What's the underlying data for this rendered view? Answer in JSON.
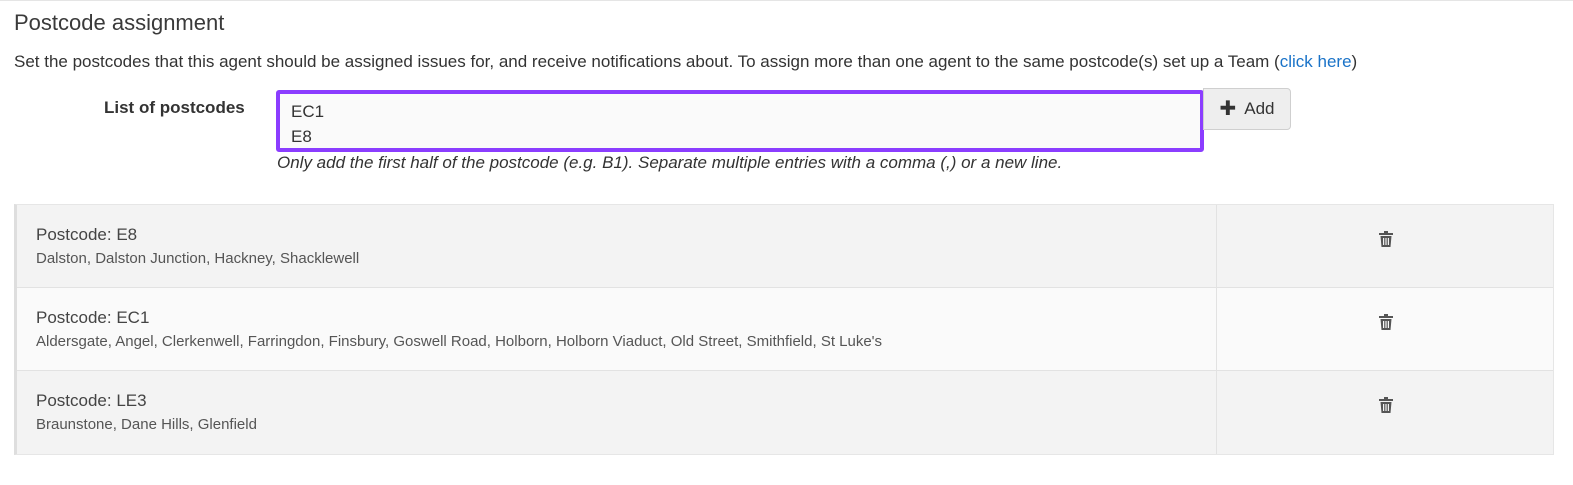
{
  "section": {
    "title": "Postcode assignment",
    "intro_text": "Set the postcodes that this agent should be assigned issues for, and receive notifications about. To assign more than one agent to the same postcode(s) set up a Team (",
    "intro_link": "click here",
    "intro_close": ")"
  },
  "form": {
    "label": "List of postcodes",
    "value": "EC1\nE8",
    "add_label": "Add",
    "add_icon": "plus-icon",
    "help_text": "Only add the first half of the postcode (e.g. B1). Separate multiple entries with a comma (,) or a new line."
  },
  "postcodes": [
    {
      "title": "Postcode: E8",
      "areas": "Dalston, Dalston Junction, Hackney, Shacklewell"
    },
    {
      "title": "Postcode: EC1",
      "areas": "Aldersgate, Angel, Clerkenwell, Farringdon, Finsbury, Goswell Road, Holborn, Holborn Viaduct, Old Street, Smithfield, St Luke's"
    },
    {
      "title": "Postcode: LE3",
      "areas": "Braunstone, Dane Hills, Glenfield"
    }
  ],
  "colors": {
    "focus_border": "#8b3dff",
    "link": "#1a73c8"
  }
}
